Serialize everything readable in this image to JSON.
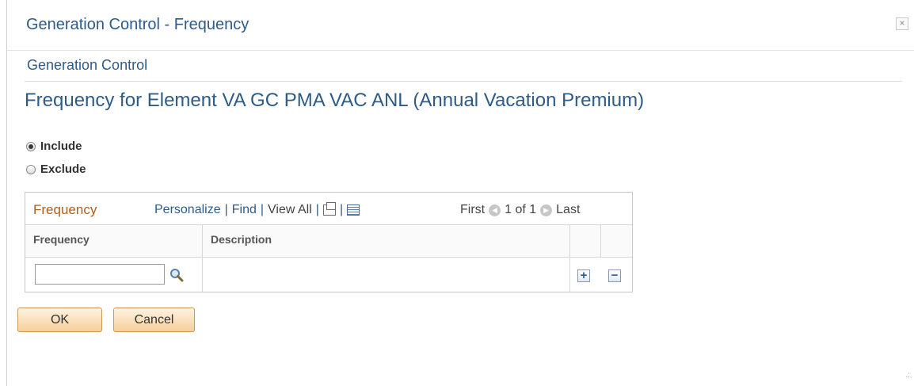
{
  "dialog": {
    "title": "Generation Control - Frequency",
    "close_label": "×"
  },
  "page": {
    "subheading": "Generation Control",
    "title": "Frequency for Element VA GC PMA VAC ANL (Annual Vacation Premium)"
  },
  "options": {
    "include_label": "Include",
    "exclude_label": "Exclude",
    "selected": "Include"
  },
  "grid": {
    "title": "Frequency",
    "tools": {
      "personalize": "Personalize",
      "find": "Find",
      "view_all": "View All",
      "separator": "|"
    },
    "nav": {
      "first": "First",
      "position": "1 of 1",
      "last": "Last"
    },
    "columns": [
      "Frequency",
      "Description"
    ],
    "rows": [
      {
        "frequency": "",
        "description": ""
      }
    ],
    "add_row_label": "+",
    "delete_row_label": "−"
  },
  "buttons": {
    "ok": "OK",
    "cancel": "Cancel"
  },
  "colors": {
    "title_blue": "#2d5c88",
    "grid_title_orange": "#b15e1a",
    "button_fill": "#f5cf9a"
  },
  "icons": {
    "close": "close-icon",
    "lookup": "magnifier-icon",
    "new_window": "new-window-icon",
    "download": "spreadsheet-icon",
    "prev": "arrow-left-icon",
    "next": "arrow-right-icon"
  }
}
